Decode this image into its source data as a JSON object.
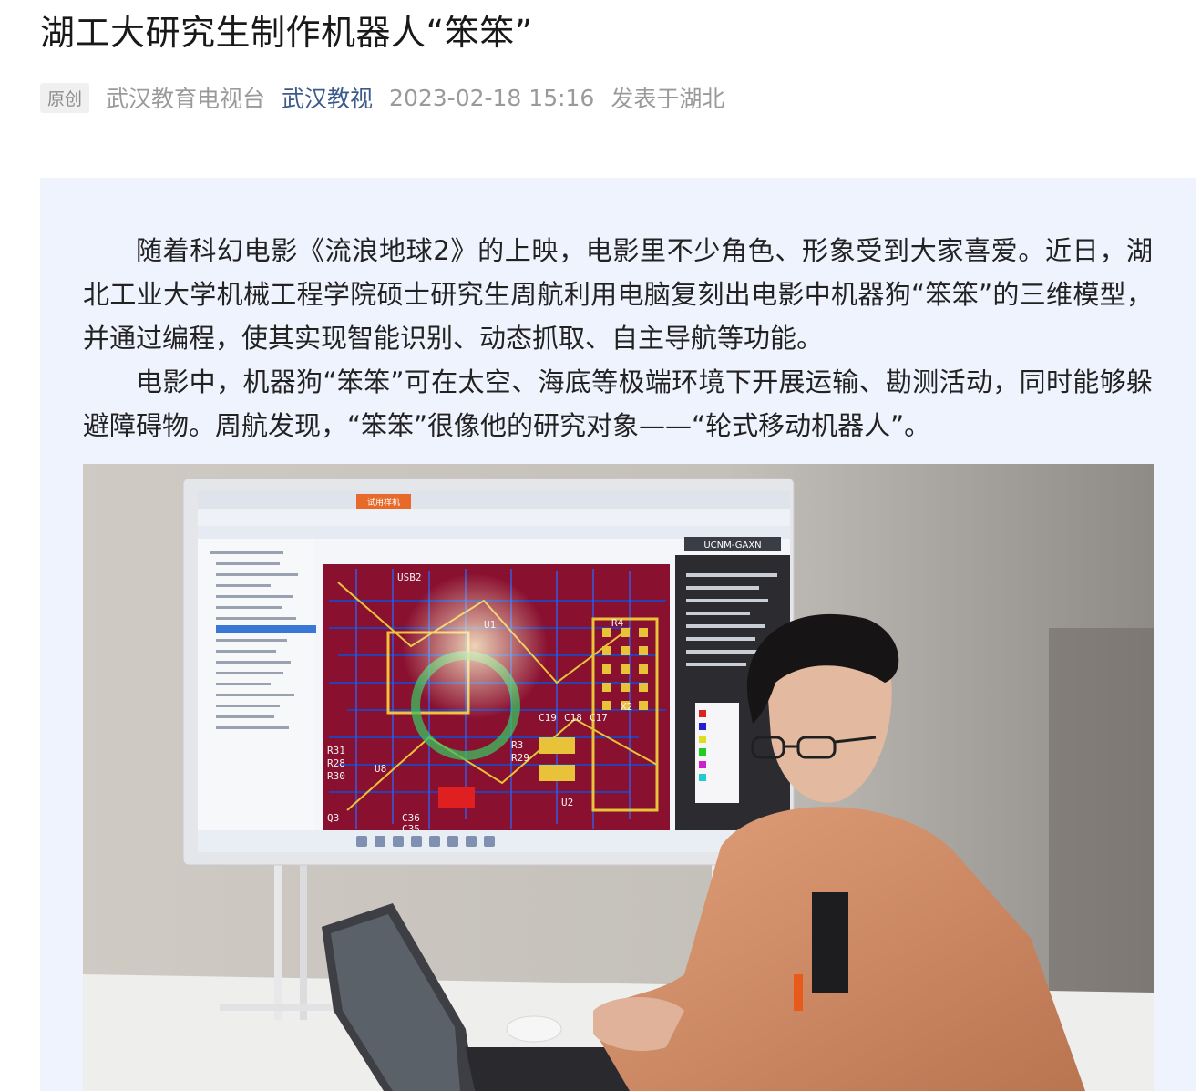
{
  "article": {
    "title": "湖工大研究生制作机器人“笨笨”",
    "tag": "原创",
    "source": "武汉教育电视台",
    "media": "武汉教视",
    "datetime": "2023-02-18 15:16",
    "location": "发表于湖北"
  },
  "content": {
    "paragraphs": [
      "随着科幻电影《流浪地球2》的上映，电影里不少角色、形象受到大家喜爱。近日，湖北工业大学机械工程学院硕士研究生周航利用电脑复刻出电影中机器狗“笨笨”的三维模型，并通过编程，使其实现智能识别、动态抓取、自主导航等功能。",
      "电影中，机器狗“笨笨”可在太空、海底等极端环境下开展运输、勘测活动，同时能够躲避障碍物。周航发现，“笨笨”很像他的研究对象——“轮式移动机器人”。"
    ]
  },
  "photo": {
    "screen_tab": "试用样机",
    "screen_code": "UCNM-GAXN",
    "pcb_labels": {
      "usb": "USB2",
      "u1": "U1",
      "u8": "U8",
      "u2": "U2",
      "q3": "Q3",
      "r_left": [
        "R31",
        "R28",
        "R30"
      ],
      "r_small": [
        "R3",
        "R29"
      ],
      "c_mid": [
        "C19",
        "C18",
        "C17"
      ],
      "c_low": [
        "C36",
        "C35"
      ],
      "x2": "X2",
      "r4": "R4"
    }
  },
  "colors": {
    "link": "#3c5a8c",
    "box_bg": "#eff3fd",
    "meta_gray": "#9a9a9a",
    "jacket": "#d08a62"
  }
}
